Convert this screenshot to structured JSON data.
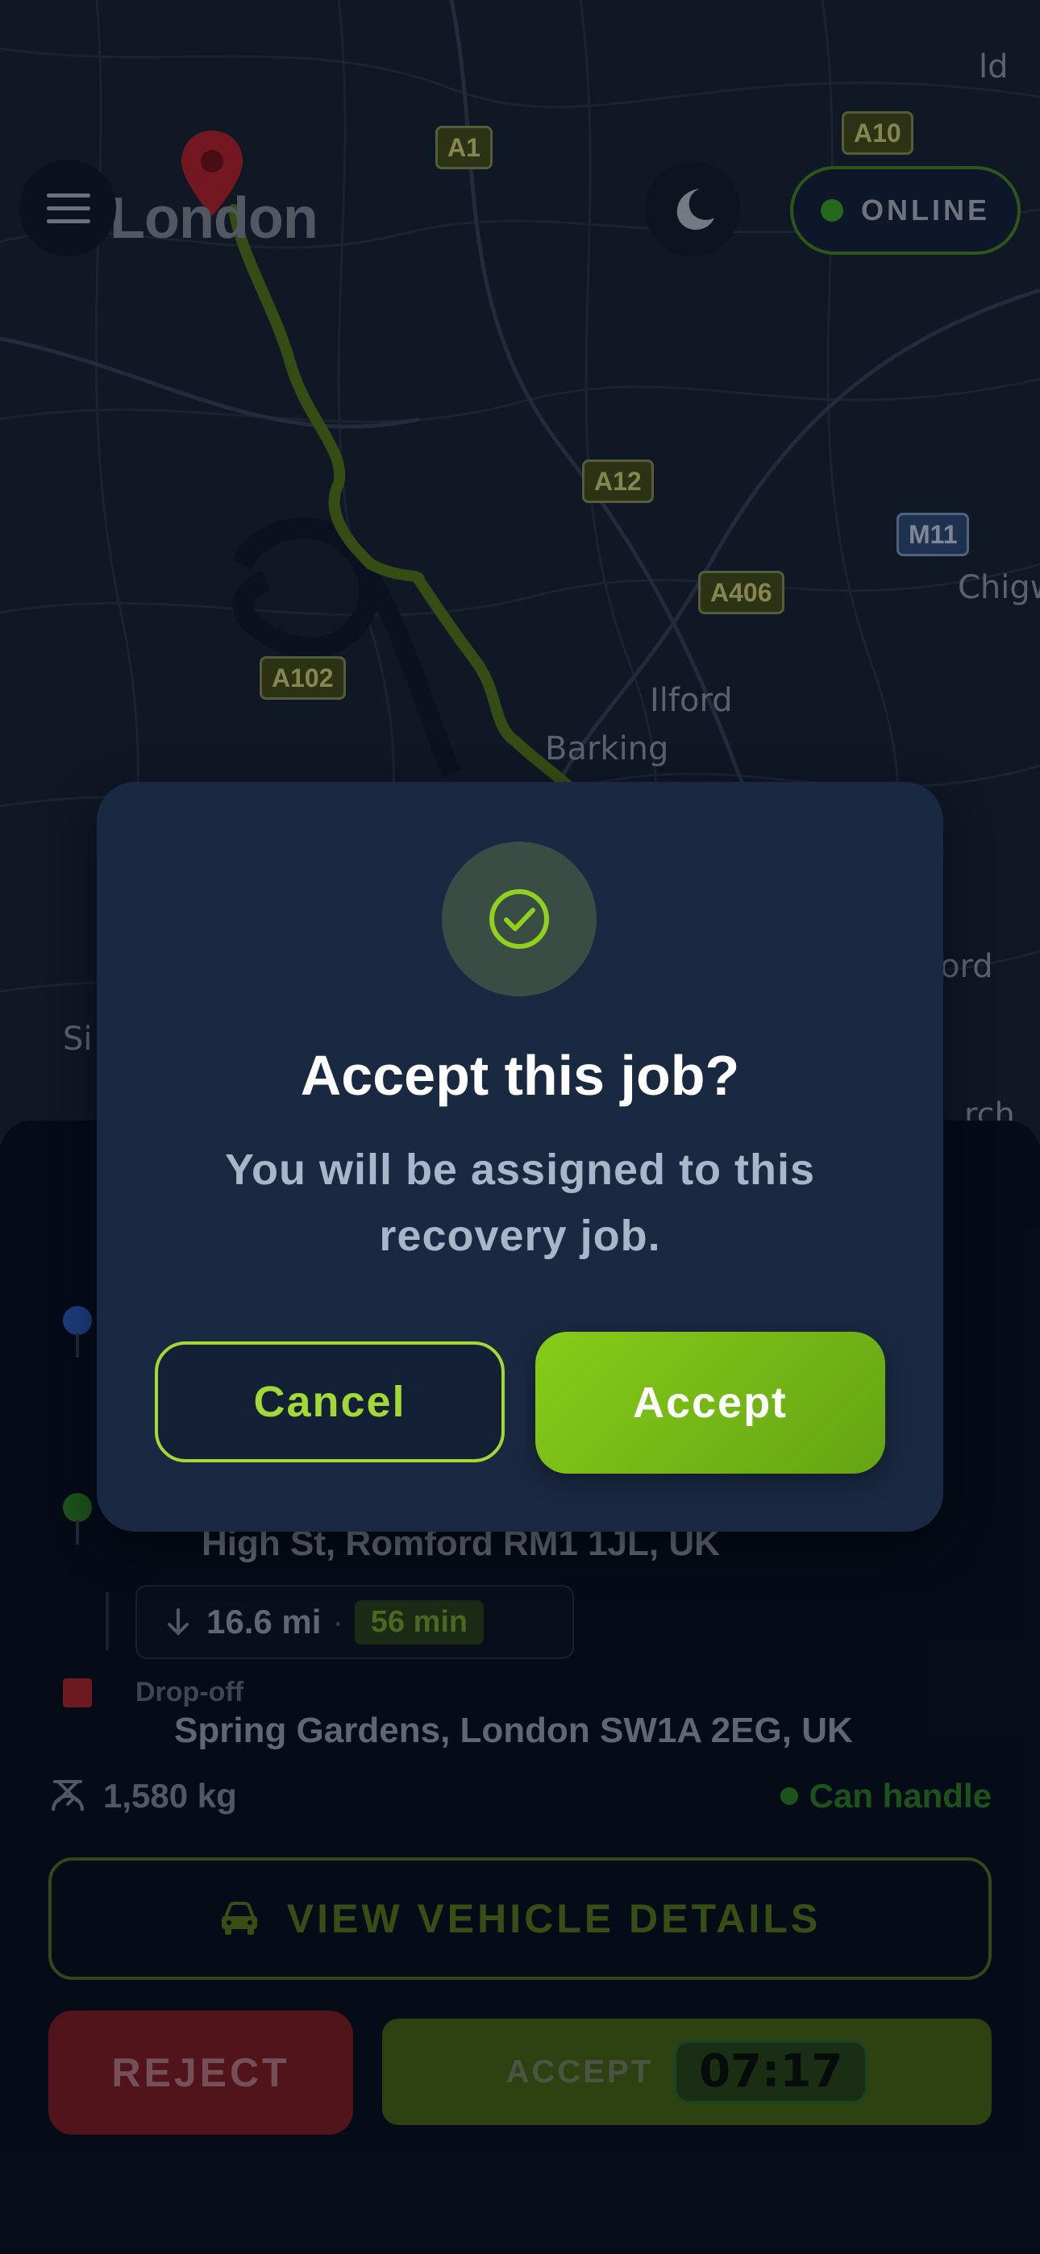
{
  "map": {
    "city_label": "London",
    "place_labels": [
      "ld",
      "Chigw",
      "Ilford",
      "Barking",
      "ord",
      "Si",
      "rch"
    ],
    "road_badges": [
      "A1",
      "A10",
      "A12",
      "M11",
      "A406",
      "A102"
    ],
    "status": "ONLINE"
  },
  "job": {
    "pickup_address": "High St, Romford RM1 1JL, UK",
    "distance": "16.6 mi",
    "separator": "·",
    "duration": "56 min",
    "dropoff_label": "Drop-off",
    "dropoff_address": "Spring Gardens, London SW1A 2EG, UK",
    "weight": "1,580 kg",
    "capability": "Can handle"
  },
  "actions": {
    "view_vehicle": "VIEW VEHICLE DETAILS",
    "reject": "REJECT",
    "accept": "ACCEPT",
    "timer": "07:17"
  },
  "dialog": {
    "title": "Accept this job?",
    "message": "You will be assigned to this recovery job.",
    "cancel_label": "Cancel",
    "accept_label": "Accept"
  },
  "colors": {
    "accent": "#86cc19",
    "route": "#5b7e16",
    "reject": "#8b1e22",
    "online": "#3fae25"
  }
}
